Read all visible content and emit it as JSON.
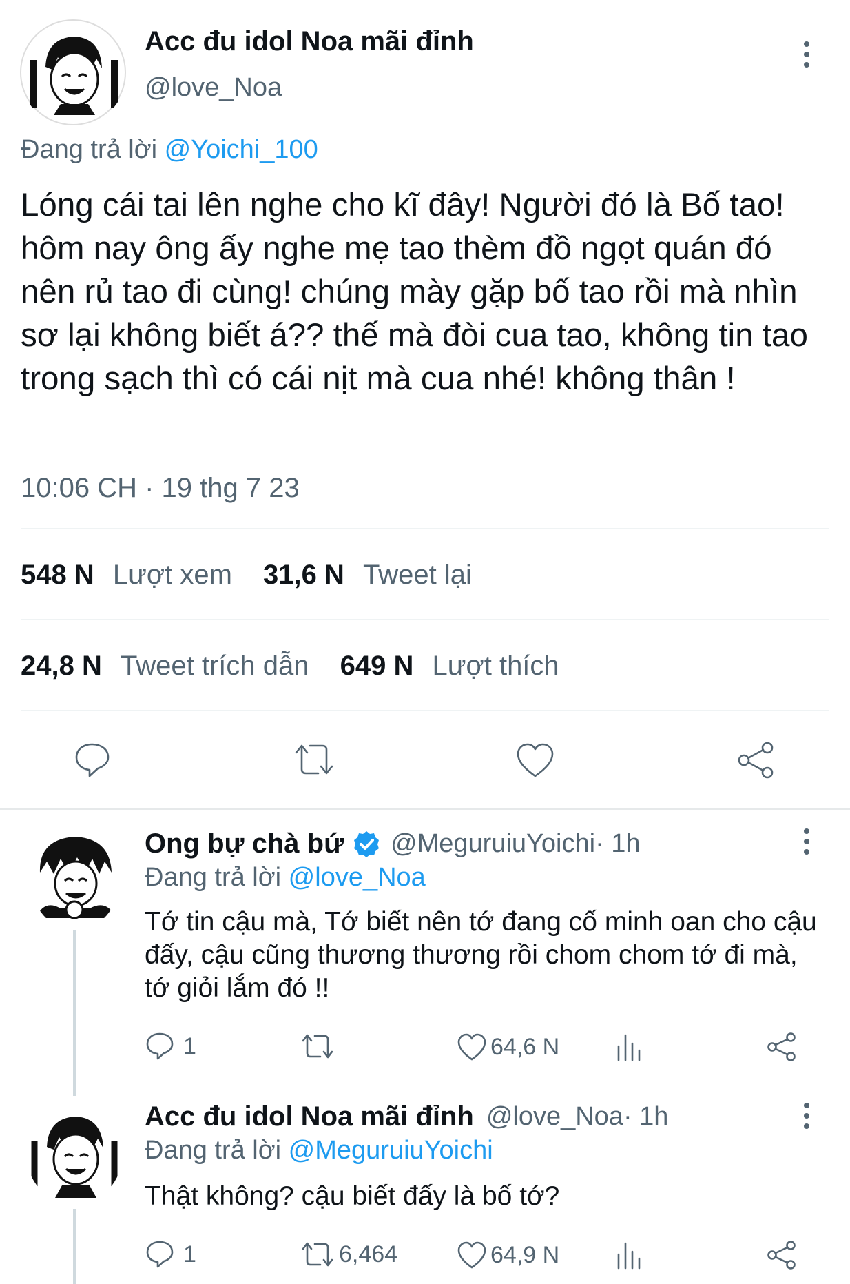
{
  "main_tweet": {
    "display_name": "Acc đu idol Noa mãi đỉnh",
    "handle": "@love_Noa",
    "reply_prefix": "Đang trả lời",
    "reply_to": "@Yoichi_100",
    "text": "Lóng cái tai lên nghe cho kĩ đây! Người đó là Bố tao! hôm nay ông ấy nghe mẹ tao thèm đồ ngọt quán đó nên rủ tao đi cùng! chúng mày gặp bố tao rồi mà nhìn sơ lại không biết á?? thế mà đòi cua tao, không tin tao trong sạch thì có cái nịt mà cua nhé! không thân !",
    "timestamp": "10:06 CH · 19 thg 7 23",
    "stats": {
      "views_count": "548 N",
      "views_label": "Lượt xem",
      "retweets_count": "31,6 N",
      "retweets_label": "Tweet lại",
      "quotes_count": "24,8 N",
      "quotes_label": "Tweet trích dẫn",
      "likes_count": "649 N",
      "likes_label": "Lượt thích"
    }
  },
  "replies": [
    {
      "display_name": "Ong bự chà bứ",
      "verified": true,
      "handle": "@MeguruiuYoichi",
      "time": " · 1h",
      "reply_prefix": "Đang trả lời",
      "reply_to": "@love_Noa",
      "text": "Tớ tin cậu mà, Tớ biết nên tớ đang cố minh oan cho cậu đấy, cậu cũng thương thương rồi chom chom tớ đi mà, tớ giỏi lắm đó !!",
      "reply_count": "1",
      "retweet_count": "",
      "like_count": "64,6 N"
    },
    {
      "display_name": "Acc đu idol Noa mãi đỉnh",
      "verified": false,
      "handle": "@love_Noa",
      "time": " · 1h",
      "reply_prefix": "Đang trả lời",
      "reply_to": "@MeguruiuYoichi",
      "text": "Thật không? cậu biết đấy là bố tớ?",
      "reply_count": "1",
      "retweet_count": "6,464",
      "like_count": "64,9 N"
    }
  ],
  "icons": {
    "reply": "reply-icon",
    "retweet": "retweet-icon",
    "like": "heart-icon",
    "share": "share-icon",
    "views": "bar-chart-icon",
    "more": "more-vertical-icon",
    "verified": "verified-badge-icon"
  },
  "colors": {
    "accent": "#1d9bf0",
    "muted": "#536471",
    "text": "#0f1419",
    "divider": "#eff3f4"
  }
}
